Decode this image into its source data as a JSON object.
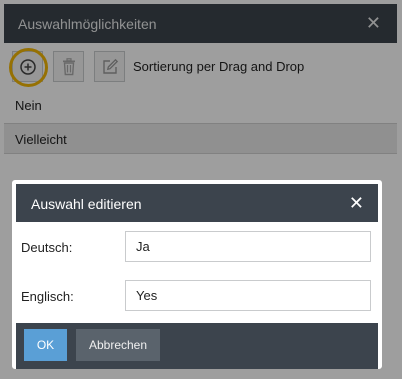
{
  "base_dialog": {
    "title": "Auswahlmöglichkeiten",
    "close_symbol": "✕",
    "toolbar": {
      "add_icon": "plus-circle-icon",
      "delete_icon": "trash-icon",
      "edit_icon": "edit-icon",
      "sort_label": "Sortierung per Drag and Drop"
    },
    "items": [
      {
        "label": "Nein",
        "selected": false
      },
      {
        "label": "Vielleicht",
        "selected": true
      }
    ]
  },
  "edit_dialog": {
    "title": "Auswahl editieren",
    "close_symbol": "✕",
    "fields": [
      {
        "label": "Deutsch:",
        "value": "Ja"
      },
      {
        "label": "Englisch:",
        "value": "Yes"
      }
    ],
    "ok_label": "OK",
    "cancel_label": "Abbrechen"
  },
  "colors": {
    "header_bg": "#3c444d",
    "ok_bg": "#5a9fd6",
    "highlight_ring": "#f2b705"
  }
}
